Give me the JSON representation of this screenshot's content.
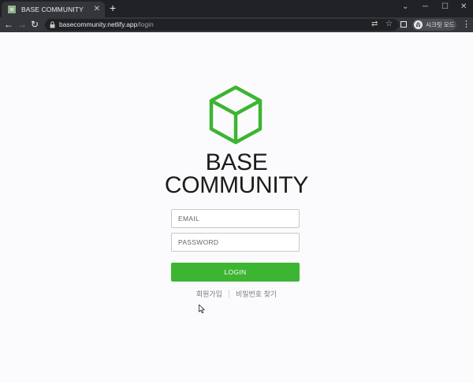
{
  "browser": {
    "tab_title": "BASE COMMUNITY",
    "tab_close_glyph": "✕",
    "new_tab_glyph": "+",
    "url_domain": "basecommunity.netlify.app",
    "url_path": "/login",
    "profile_label": "시크릿 모드",
    "window_controls": {
      "chevron": "⌄",
      "minimize": "─",
      "maximize": "☐",
      "close": "✕"
    },
    "nav": {
      "back": "←",
      "forward": "→",
      "reload": "↻"
    },
    "omnibox_icons": {
      "translate": "⇄",
      "bookmark": "☆"
    },
    "menu_glyph": "⋮"
  },
  "page": {
    "brand_line1": "BASE",
    "brand_line2": "COMMUNITY",
    "email_placeholder": "EMAIL",
    "password_placeholder": "PASSWORD",
    "login_label": "LOGIN",
    "signup_link": "회원가입",
    "find_password_link": "비밀번호 찾기"
  },
  "colors": {
    "accent": "#3cb532",
    "logo": "#3cb532",
    "chrome_dark": "#202124",
    "chrome_tab": "#35363a"
  },
  "icons": [
    "cube-logo-icon",
    "lock-icon",
    "translate-icon",
    "bookmark-star-icon",
    "side-panel-icon",
    "incognito-icon",
    "menu-icon",
    "mouse-cursor-icon"
  ]
}
